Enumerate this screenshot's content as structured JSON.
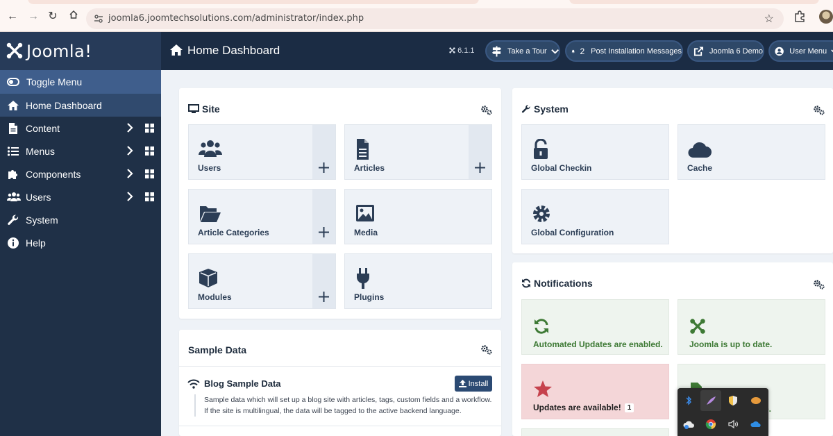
{
  "browser": {
    "url": "joomla6.joomtechsolutions.com/administrator/index.php"
  },
  "brand": {
    "logo_text": "Joomla!"
  },
  "sidebar": {
    "items": [
      {
        "label": "Toggle Menu",
        "icon": "toggle-icon"
      },
      {
        "label": "Home Dashboard",
        "icon": "home-icon"
      },
      {
        "label": "Content",
        "icon": "file-icon"
      },
      {
        "label": "Menus",
        "icon": "list-icon"
      },
      {
        "label": "Components",
        "icon": "puzzle-icon"
      },
      {
        "label": "Users",
        "icon": "users-icon"
      },
      {
        "label": "System",
        "icon": "wrench-icon"
      },
      {
        "label": "Help",
        "icon": "info-icon"
      }
    ]
  },
  "header": {
    "title": "Home Dashboard",
    "version": "6.1.1",
    "tour_label": "Take a Tour",
    "messages_count": "2",
    "messages_label": "Post Installation Messages",
    "demo_label": "Joomla 6 Demo",
    "user_label": "User Menu"
  },
  "site": {
    "title": "Site",
    "tiles": [
      "Users",
      "Articles",
      "Article Categories",
      "Media",
      "Modules",
      "Plugins"
    ]
  },
  "system": {
    "title": "System",
    "tiles": [
      "Global Checkin",
      "Cache",
      "Global Configuration"
    ]
  },
  "notifications": {
    "title": "Notifications",
    "tiles": [
      "Automated Updates are enabled.",
      "Joomla is up to date.",
      "Updates are available!"
    ],
    "updates_count": "1",
    "partial_text": "te."
  },
  "sample_data": {
    "title": "Sample Data",
    "blog_title": "Blog Sample Data",
    "install_label": "Install",
    "description": "Sample data which will set up a blog site with articles, tags, custom fields and a workflow. If the site is multilingual, the data will be tagged to the active backend language."
  },
  "colors": {
    "sidebar": "#1f3047",
    "header": "#1b2c44",
    "accent": "#2b4a73",
    "success": "#3e7a35",
    "danger_bg": "#f4d6d8"
  }
}
